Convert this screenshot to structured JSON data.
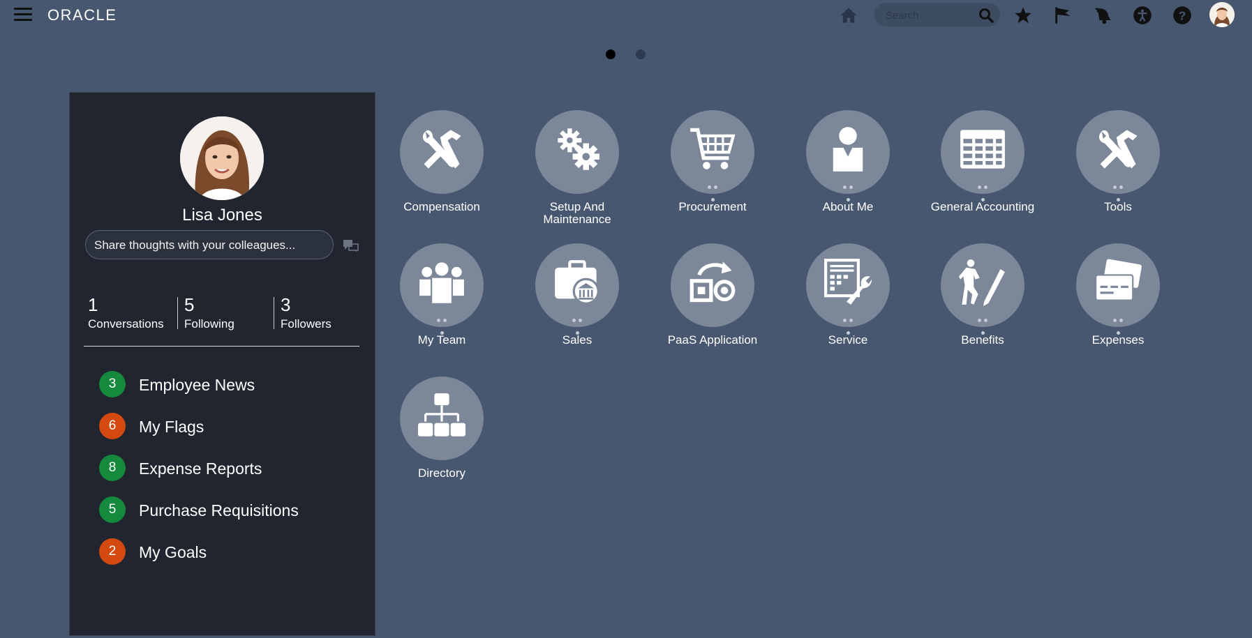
{
  "header": {
    "logo": "ORACLE",
    "search_placeholder": "Search",
    "icons": [
      "menu-icon",
      "home-icon",
      "search-icon",
      "star-icon",
      "flag-icon",
      "bell-icon",
      "accessibility-icon",
      "help-icon",
      "user-avatar"
    ]
  },
  "pager": {
    "pages": 2,
    "active": 1
  },
  "profile": {
    "name": "Lisa Jones",
    "share_placeholder": "Share thoughts with your colleagues...",
    "stats": [
      {
        "value": "1",
        "label": "Conversations"
      },
      {
        "value": "5",
        "label": "Following"
      },
      {
        "value": "3",
        "label": "Followers"
      }
    ]
  },
  "news": [
    {
      "count": "3",
      "label": "Employee News",
      "color": "#168a3c"
    },
    {
      "count": "6",
      "label": "My Flags",
      "color": "#d3490f"
    },
    {
      "count": "8",
      "label": "Expense Reports",
      "color": "#168a3c"
    },
    {
      "count": "5",
      "label": "Purchase Requisitions",
      "color": "#168a3c"
    },
    {
      "count": "2",
      "label": "My Goals",
      "color": "#d3490f"
    }
  ],
  "apps": [
    {
      "label": "Compensation",
      "icon": "tools-icon"
    },
    {
      "label": "Setup And Maintenance",
      "icon": "gears-icon"
    },
    {
      "label": "Procurement",
      "icon": "cart-icon"
    },
    {
      "label": "About Me",
      "icon": "person-icon"
    },
    {
      "label": "General Accounting",
      "icon": "ledger-icon"
    },
    {
      "label": "Tools",
      "icon": "tools-icon"
    },
    {
      "label": "My Team",
      "icon": "team-icon"
    },
    {
      "label": "Sales",
      "icon": "briefcase-bank-icon"
    },
    {
      "label": "PaaS Application",
      "icon": "paas-icon"
    },
    {
      "label": "Service",
      "icon": "service-icon"
    },
    {
      "label": "Benefits",
      "icon": "benefits-icon"
    },
    {
      "label": "Expenses",
      "icon": "cards-icon"
    },
    {
      "label": "Directory",
      "icon": "org-chart-icon"
    }
  ],
  "colors": {
    "background": "#475770",
    "panel": "#20252f",
    "tile": "#7c8799",
    "green_badge": "#168a3c",
    "orange_badge": "#d3490f"
  }
}
